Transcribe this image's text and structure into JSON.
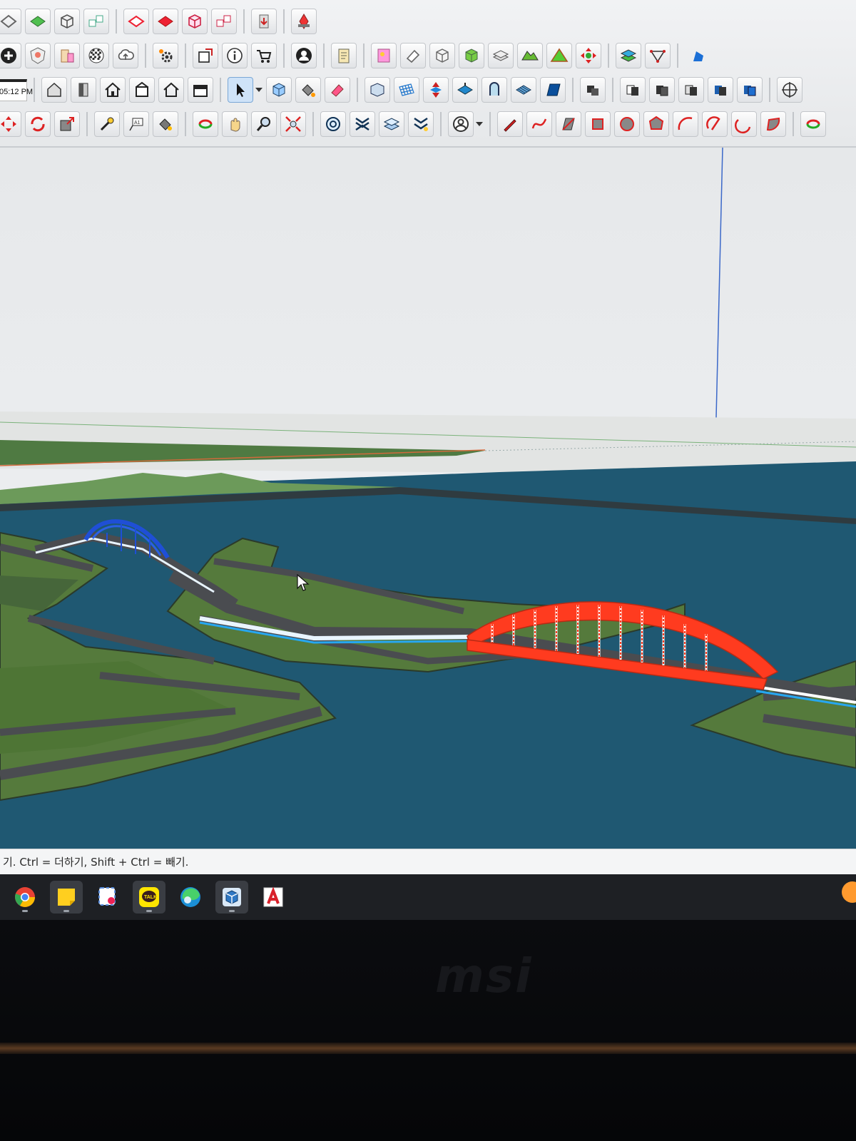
{
  "window": {
    "app": "SketchUp",
    "clock": "05:12 PM"
  },
  "toolbar": {
    "row1": [
      "eraser-outline-icon",
      "green-face-icon",
      "box-icon",
      "multi-box-icon",
      "red-outline-icon",
      "red-face-icon",
      "solid-box-icon",
      "group-boxes-icon",
      "paste-icon",
      "push-pin-icon"
    ],
    "row2": [
      "plus-circle-icon",
      "shield-map-icon",
      "building-icon",
      "checker-icon",
      "cloud-icon",
      "gear-icon",
      "component-icon",
      "info-icon",
      "cart-icon",
      "user-icon",
      "clipboard-icon",
      "paint-icon",
      "eraser-icon",
      "cube-3d-icon",
      "green-cube-icon",
      "layers-icon",
      "terrain-icon",
      "mountain-icon",
      "move-arrows-icon",
      "layer-stack-icon",
      "vertex-icon",
      "blue-shape-icon"
    ],
    "row3": [
      "house-3d-icon",
      "door-icon",
      "home-icon",
      "roof-icon",
      "house-outline-icon",
      "garage-icon",
      "select-arrow-icon",
      "dropdown-icon",
      "make-component-icon",
      "paint-bucket-icon",
      "eraser-pink-icon",
      "scene-icon",
      "grid-icon",
      "push-icon",
      "sandbox-icon",
      "follow-icon",
      "texture-icon",
      "section-icon",
      "shadow-icon",
      "view-front-icon",
      "view-back-icon",
      "view-left-icon",
      "view-right-icon",
      "view-top-icon",
      "orbit-icon"
    ],
    "row4": [
      "move-icon",
      "rotate-icon",
      "scale-icon",
      "tape-icon",
      "text-icon",
      "paint2-icon",
      "orbit2-icon",
      "pan-icon",
      "zoom-icon",
      "zoom-extents-icon",
      "outliner-icon",
      "x-ray-icon",
      "layers2-icon",
      "styles-icon",
      "account-icon",
      "account-dropdown-icon",
      "pencil-icon",
      "freehand-icon",
      "rect-icon",
      "rotated-rect-icon",
      "circle-icon",
      "polygon-icon",
      "arc-icon",
      "arc2-icon",
      "arc3-icon",
      "pie-icon",
      "orbit3-icon"
    ]
  },
  "viewport": {
    "scene": "bridge-model",
    "colors": {
      "water": "#1f5872",
      "land": "#557a3c",
      "road": "#4a4c50",
      "arch_main": "#ff3b1f",
      "arch_small": "#1f4fd6",
      "deck_edge": "#27a7f0"
    }
  },
  "statusbar": {
    "hint": "기. Ctrl = 더하기, Shift + Ctrl = 빼기."
  },
  "taskbar": {
    "apps": [
      "chrome-icon",
      "sticky-notes-icon",
      "snipping-icon",
      "kakaotalk-icon",
      "edge-icon",
      "sketchup-icon",
      "autocad-icon"
    ]
  },
  "bezel": {
    "brand": "msi"
  }
}
